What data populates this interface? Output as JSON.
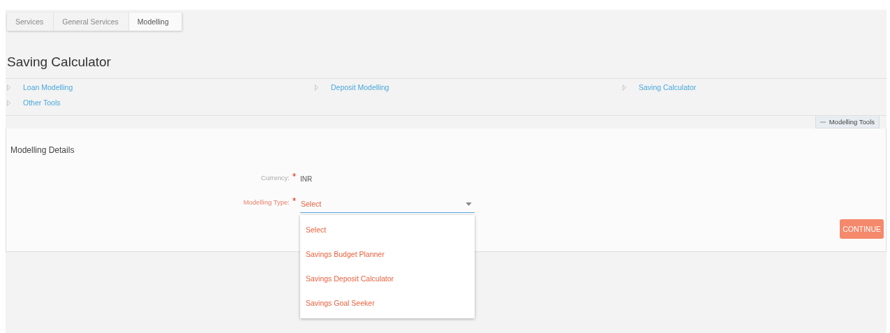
{
  "breadcrumb": [
    {
      "label": "Services",
      "selected": false
    },
    {
      "label": "General Services",
      "selected": false
    },
    {
      "label": "Modelling",
      "selected": true
    }
  ],
  "page_title": "Saving Calculator",
  "tool_links": [
    {
      "label": "Loan Modelling"
    },
    {
      "label": "Deposit Modelling"
    },
    {
      "label": "Saving Calculator"
    },
    {
      "label": "Other Tools"
    }
  ],
  "panel_tab": "Modelling Tools",
  "section_title": "Modelling Details",
  "currency": {
    "label": "Currency:",
    "required": true,
    "value": "INR"
  },
  "modelling_type": {
    "label": "Modelling Type:",
    "required": true,
    "value": "Select",
    "expanded": true,
    "options": [
      "Select",
      "Savings Budget Planner",
      "Savings Deposit Calculator",
      "Savings Goal Seeker"
    ]
  },
  "continue_button": "CONTINUE"
}
